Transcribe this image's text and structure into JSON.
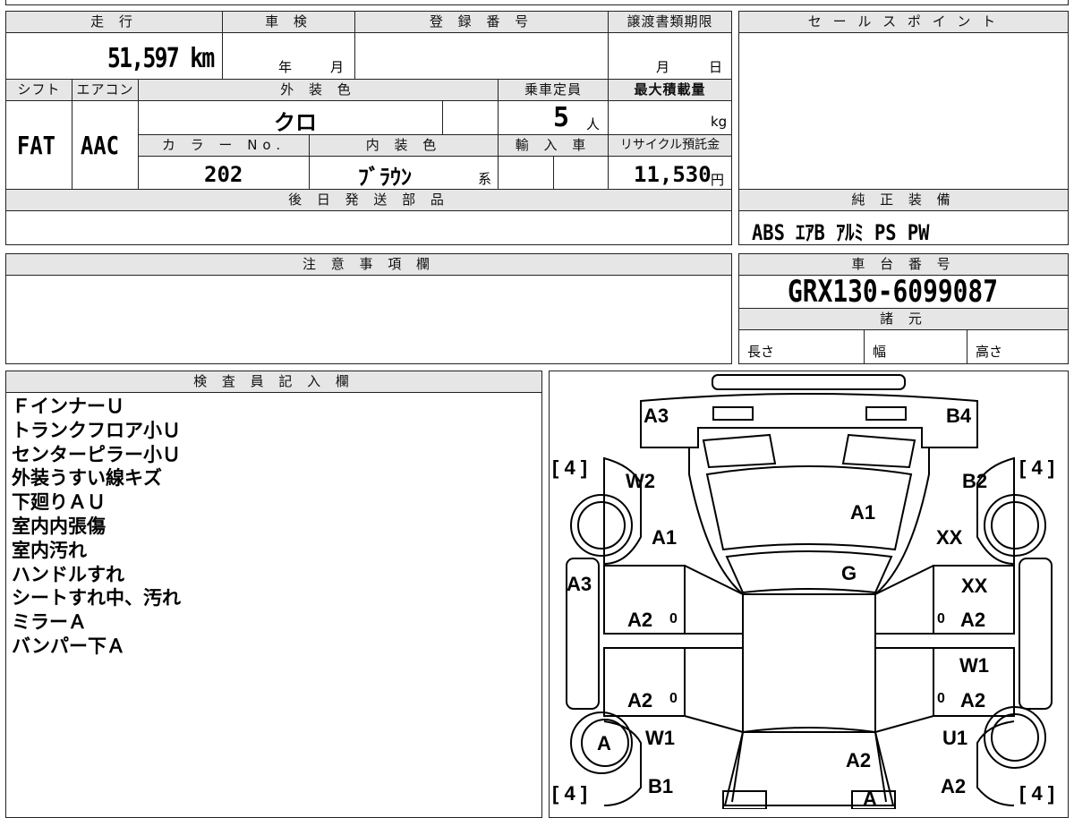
{
  "headers": {
    "mileage": "走 行",
    "shaken": "車 検",
    "registration": "登 録 番 号",
    "transfer_deadline": "譲渡書類期限",
    "sales_point": "セ ー ル ス ポ イ ン ト",
    "shift": "シフト",
    "aircon": "エアコン",
    "exterior_color": "外 装 色",
    "capacity": "乗車定員",
    "max_load": "最大積載量",
    "color_no": "カ ラ ー No.",
    "interior_color": "内 装 色",
    "import": "輸 入 車",
    "recycle": "リサイクル預託金",
    "later_parts": "後 日 発 送 部 品",
    "genuine_equipment": "純 正 装 備",
    "caution": "注 意 事 項 欄",
    "chassis_no": "車 台 番 号",
    "specs": "諸 元",
    "inspector": "検 査 員 記 入 欄"
  },
  "values": {
    "mileage": "51,597 km",
    "shaken_year": "年",
    "shaken_month": "月",
    "transfer_month": "月",
    "transfer_day": "日",
    "shift": "FAT",
    "aircon": "AAC",
    "exterior_color": "クロ",
    "capacity": "5",
    "capacity_unit": "人",
    "max_load_unit": "kg",
    "color_no": "202",
    "interior_color": "ﾌﾞﾗｳﾝ",
    "interior_suffix": "系",
    "recycle": "11,530",
    "recycle_unit": "円",
    "equipment": "ABS ｴｱB ｱﾙﾐ PS PW",
    "chassis_no": "GRX130-6099087",
    "length": "長さ",
    "width": "幅",
    "height": "高さ"
  },
  "inspector_notes": [
    "ＦインナーＵ",
    "トランクフロア小Ｕ",
    "センターピラー小Ｕ",
    "外装うすい線キズ",
    "下廻りＡＵ",
    "室内内張傷",
    "室内汚れ",
    "ハンドルすれ",
    "シートすれ中、汚れ",
    "ミラーＡ",
    "バンパー下Ａ"
  ],
  "diagram": {
    "bracket_fl": "[ 4 ]",
    "bracket_fr": "[ 4 ]",
    "bracket_rl": "[ 4 ]",
    "bracket_rr": "[ 4 ]",
    "marks": {
      "front_left_corner": "A3",
      "front_right_corner": "B4",
      "left_front_fender": "W2",
      "right_front_fender": "B2",
      "hood": "A1",
      "left_fender": "A1",
      "right_fender": "XX",
      "windshield": "G",
      "left_side": "A3",
      "right_front_pillar": "XX",
      "left_front_door": "A2",
      "right_front_door": "A2",
      "right_rear_upper": "W1",
      "left_rear_door": "A2",
      "right_rear_door": "A2",
      "left_rear_wheel": "A",
      "left_rear_fender": "W1",
      "right_rear_fender": "U1",
      "left_rear_lower": "B1",
      "roof_rear": "A2",
      "right_rear_lower": "A2",
      "trunk_bottom": "A",
      "zero_lf": "0",
      "zero_rf": "0",
      "zero_lr": "0",
      "zero_rr": "0"
    }
  }
}
